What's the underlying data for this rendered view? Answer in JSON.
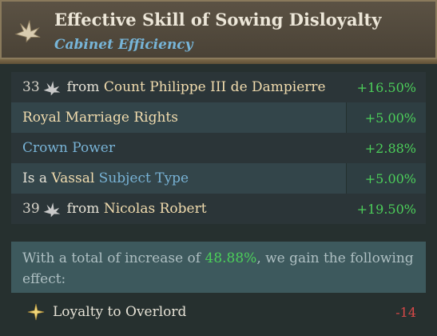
{
  "header": {
    "title": "Effective Skill of Sowing Disloyalty",
    "subtitle": "Cabinet Efficiency",
    "icon": "dove-icon"
  },
  "rows": [
    {
      "num": "33",
      "prefix": "from",
      "name": "Count Philippe III de Dampierre",
      "value": "+16.50%"
    },
    {
      "name": "Royal Marriage Rights",
      "value": "+5.00%"
    },
    {
      "name": "Crown Power",
      "value": "+2.88%"
    },
    {
      "prefix": "Is a",
      "gold": "Vassal",
      "blue": "Subject Type",
      "value": "+5.00%"
    },
    {
      "num": "39",
      "prefix": "from",
      "name": "Nicolas Robert",
      "value": "+19.50%"
    }
  ],
  "summary": {
    "text_before": "With a total of increase of",
    "percent": "48.88%",
    "text_after": ", we gain the following effect:"
  },
  "effect": {
    "label": "Loyalty to Overlord",
    "value": "-14",
    "icon": "star-icon"
  },
  "colors": {
    "positive": "#4ccf5a",
    "negative": "#d84848",
    "link_blue": "#78b3d6",
    "gold_text": "#f1dcae"
  }
}
